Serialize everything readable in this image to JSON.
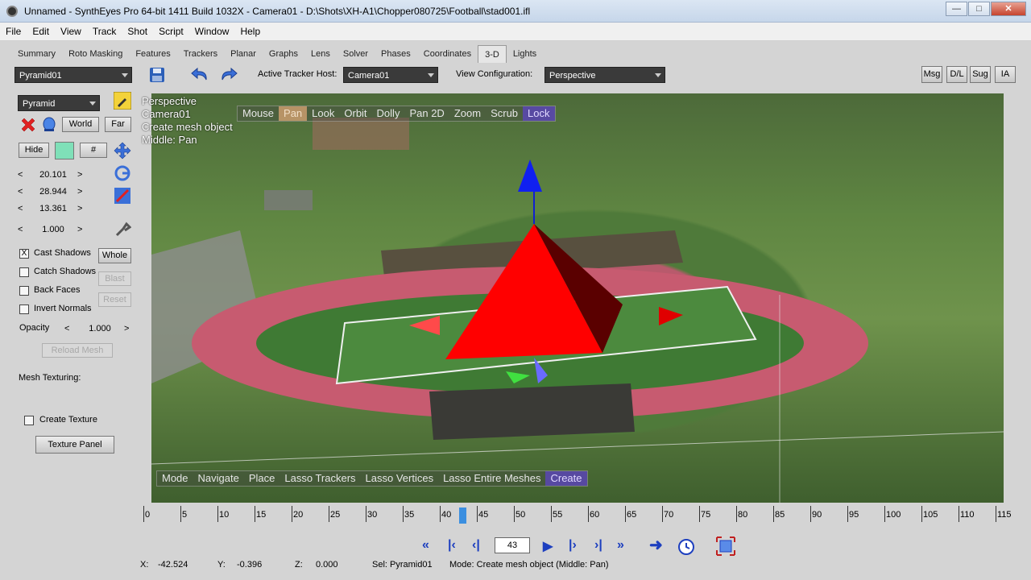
{
  "window": {
    "title": "Unnamed - SynthEyes Pro 64-bit 1411 Build 1032X - Camera01 - D:\\Shots\\XH-A1\\Chopper080725\\Football\\stad001.ifl",
    "minimize": "—",
    "maximize": "□",
    "close": "✕"
  },
  "menu": [
    "File",
    "Edit",
    "View",
    "Track",
    "Shot",
    "Script",
    "Window",
    "Help"
  ],
  "tabs": [
    "Summary",
    "Roto Masking",
    "Features",
    "Trackers",
    "Planar",
    "Graphs",
    "Lens",
    "Solver",
    "Phases",
    "Coordinates",
    "3-D",
    "Lights"
  ],
  "active_tab": "3-D",
  "toolbar": {
    "object_select": "Pyramid01",
    "active_tracker_host_label": "Active Tracker Host:",
    "active_tracker_host_value": "Camera01",
    "view_config_label": "View Configuration:",
    "view_config_value": "Perspective",
    "right_buttons": [
      "Msg",
      "D/L",
      "Sug",
      "IA"
    ]
  },
  "leftpanel": {
    "primitive_select": "Pyramid",
    "world_button": "World",
    "far_button": "Far",
    "hide_button": "Hide",
    "hash_button": "#",
    "spin1": "20.101",
    "spin2": "28.944",
    "spin3": "13.361",
    "spin4": "1.000",
    "left_arrow": "<",
    "right_arrow": ">",
    "cast_shadows": "Cast Shadows",
    "cast_shadows_mark": "X",
    "catch_shadows": "Catch Shadows",
    "back_faces": "Back Faces",
    "invert_normals": "Invert Normals",
    "whole_button": "Whole",
    "blast_button": "Blast",
    "reset_button": "Reset",
    "opacity_label": "Opacity",
    "opacity_value": "1.000",
    "reload_mesh": "Reload Mesh",
    "mesh_texturing": "Mesh Texturing:",
    "create_texture": "Create Texture",
    "texture_panel": "Texture Panel",
    "swatch_color": "#7fe0b8"
  },
  "viewport": {
    "info_lines": [
      "Perspective",
      "Camera01",
      "Create mesh object",
      "Middle: Pan"
    ],
    "top_bar": [
      "Mouse",
      "Pan",
      "Look",
      "Orbit",
      "Dolly",
      "Pan 2D",
      "Zoom",
      "Scrub",
      "Lock"
    ],
    "bottom_bar": [
      "Mode",
      "Navigate",
      "Place",
      "Lasso Trackers",
      "Lasso Vertices",
      "Lasso Entire Meshes",
      "Create"
    ]
  },
  "timeline": {
    "ticks": [
      "0",
      "5",
      "10",
      "15",
      "20",
      "25",
      "30",
      "35",
      "40",
      "45",
      "50",
      "55",
      "60",
      "65",
      "70",
      "75",
      "80",
      "85",
      "90",
      "95",
      "100",
      "105",
      "110",
      "115"
    ],
    "current_frame": "43"
  },
  "status": {
    "x_label": "X:",
    "x_value": "-42.524",
    "y_label": "Y:",
    "y_value": "-0.396",
    "z_label": "Z:",
    "z_value": "0.000",
    "sel": "Sel: Pyramid01",
    "mode": "Mode: Create mesh object (Middle: Pan)"
  }
}
